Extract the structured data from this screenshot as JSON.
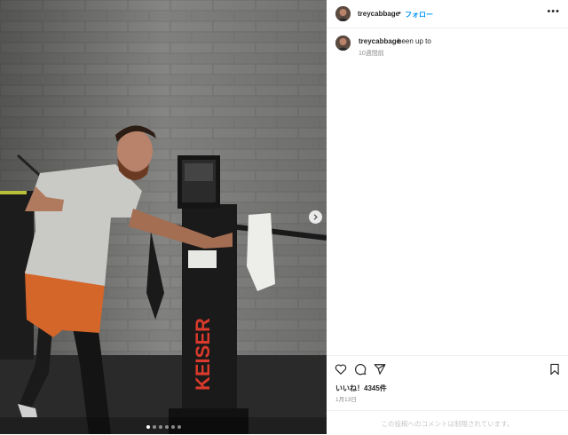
{
  "post": {
    "username": "treycabbage",
    "separator": "•",
    "follow_label": "フォロー",
    "more_label": "•••",
    "caption": "been up to",
    "caption_time": "10週間前",
    "likes": "いいね！4345件",
    "date": "1月13日",
    "comments_limited": "この投稿へのコメントは制限されています。",
    "machine_brand": "KEISER",
    "carousel": {
      "slides": 6,
      "active_index": 0
    }
  },
  "icons": [
    "heart-icon",
    "comment-icon",
    "share-icon",
    "bookmark-icon",
    "chevron-right-icon",
    "more-icon"
  ],
  "colors": {
    "follow": "#0095f6",
    "brand": "#d93a2b",
    "text": "#262626",
    "muted": "#8e8e8e",
    "shorts": "#d4662a"
  }
}
